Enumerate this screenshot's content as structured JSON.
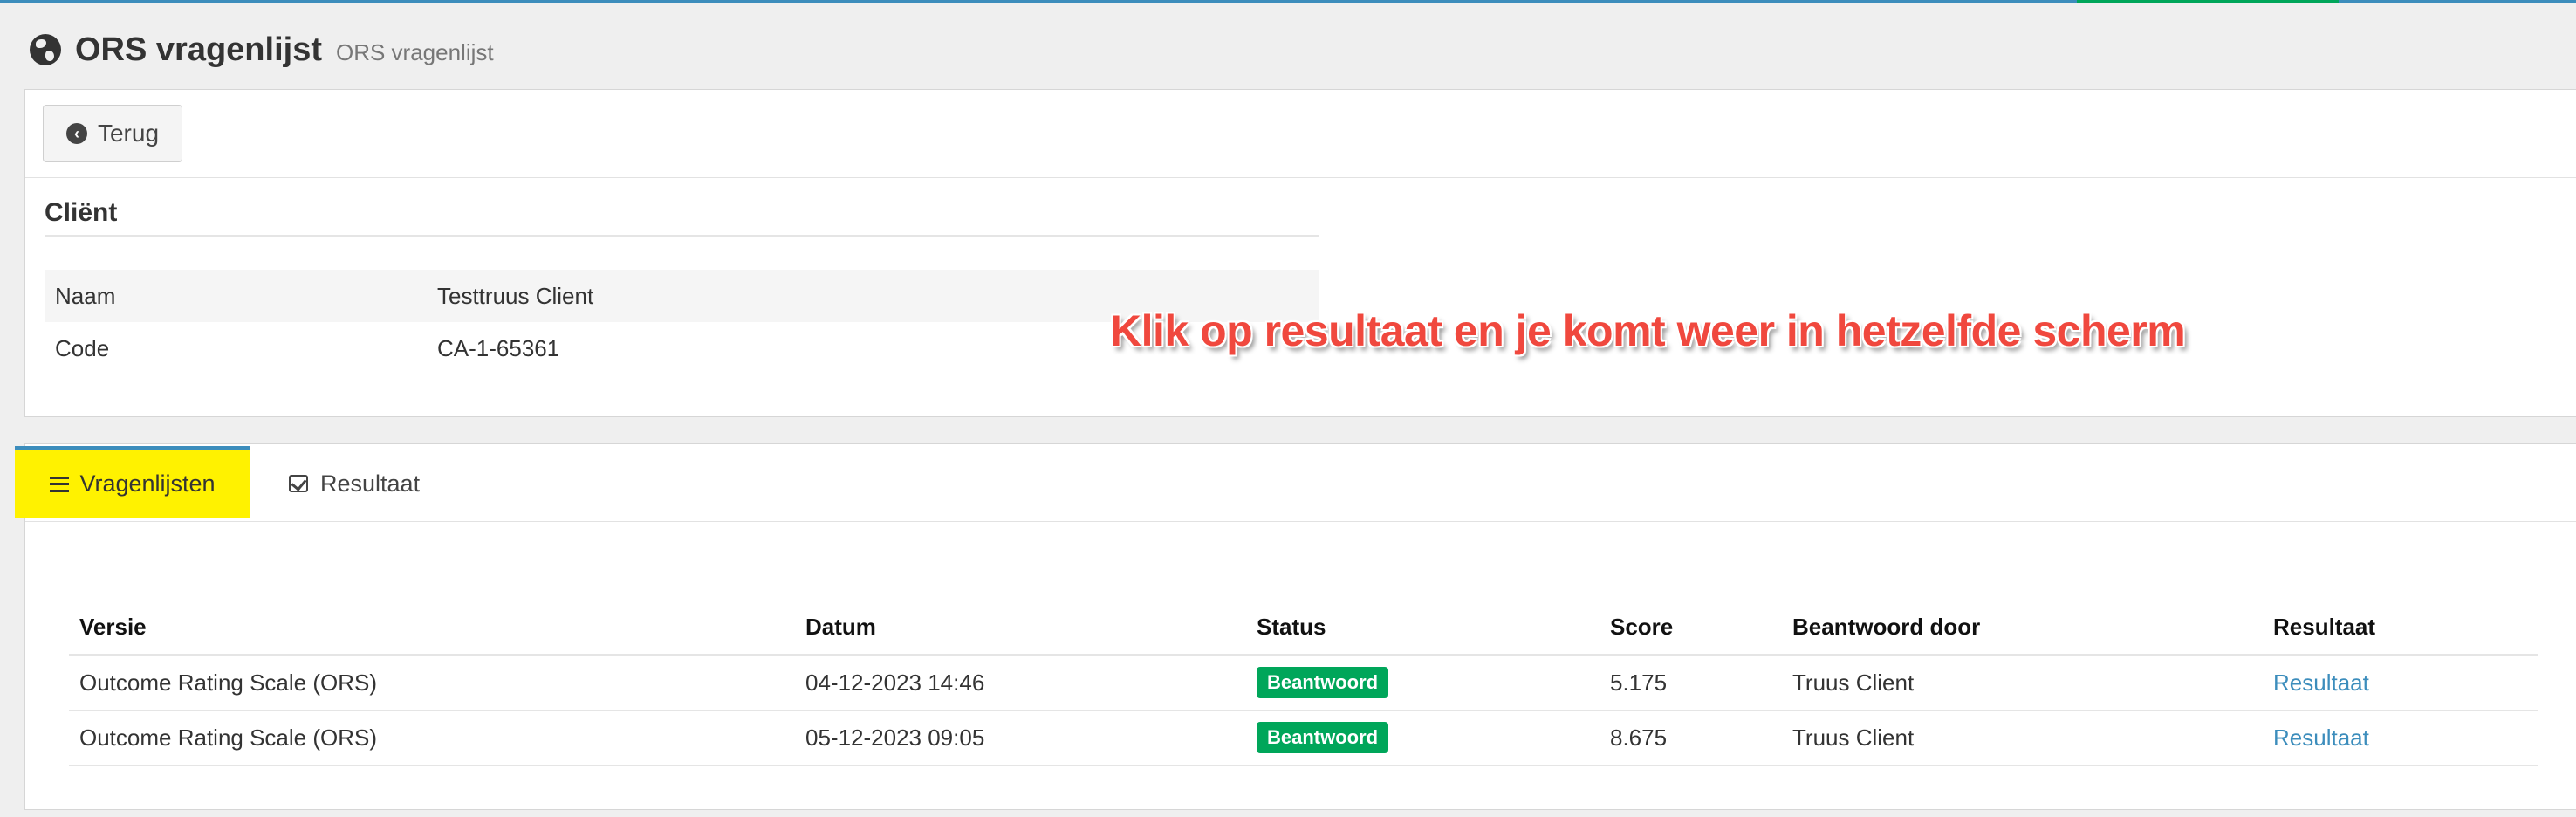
{
  "header": {
    "title": "ORS vragenlijst",
    "subtitle": "ORS vragenlijst"
  },
  "toolbar": {
    "back_label": "Terug"
  },
  "client": {
    "section_title": "Cliënt",
    "rows": [
      {
        "key": "Naam",
        "value": "Testtruus Client"
      },
      {
        "key": "Code",
        "value": "CA-1-65361"
      }
    ]
  },
  "annotation": "Klik op resultaat en je komt weer in hetzelfde scherm",
  "tabs": [
    {
      "label": "Vragenlijsten",
      "icon": "bars-icon",
      "active": true,
      "highlight": "#fff200"
    },
    {
      "label": "Resultaat",
      "icon": "check-square-icon",
      "active": false
    }
  ],
  "table": {
    "headers": [
      "Versie",
      "Datum",
      "Status",
      "Score",
      "Beantwoord door",
      "Resultaat"
    ],
    "rows": [
      {
        "versie": "Outcome Rating Scale (ORS)",
        "datum": "04-12-2023 14:46",
        "status": "Beantwoord",
        "score": "5.175",
        "door": "Truus Client",
        "resultaat": "Resultaat"
      },
      {
        "versie": "Outcome Rating Scale (ORS)",
        "datum": "05-12-2023 09:05",
        "status": "Beantwoord",
        "score": "8.675",
        "door": "Truus Client",
        "resultaat": "Resultaat"
      }
    ]
  },
  "colors": {
    "accent": "#3c8dbc",
    "success": "#00a65a",
    "annotation": "#f0483e"
  }
}
